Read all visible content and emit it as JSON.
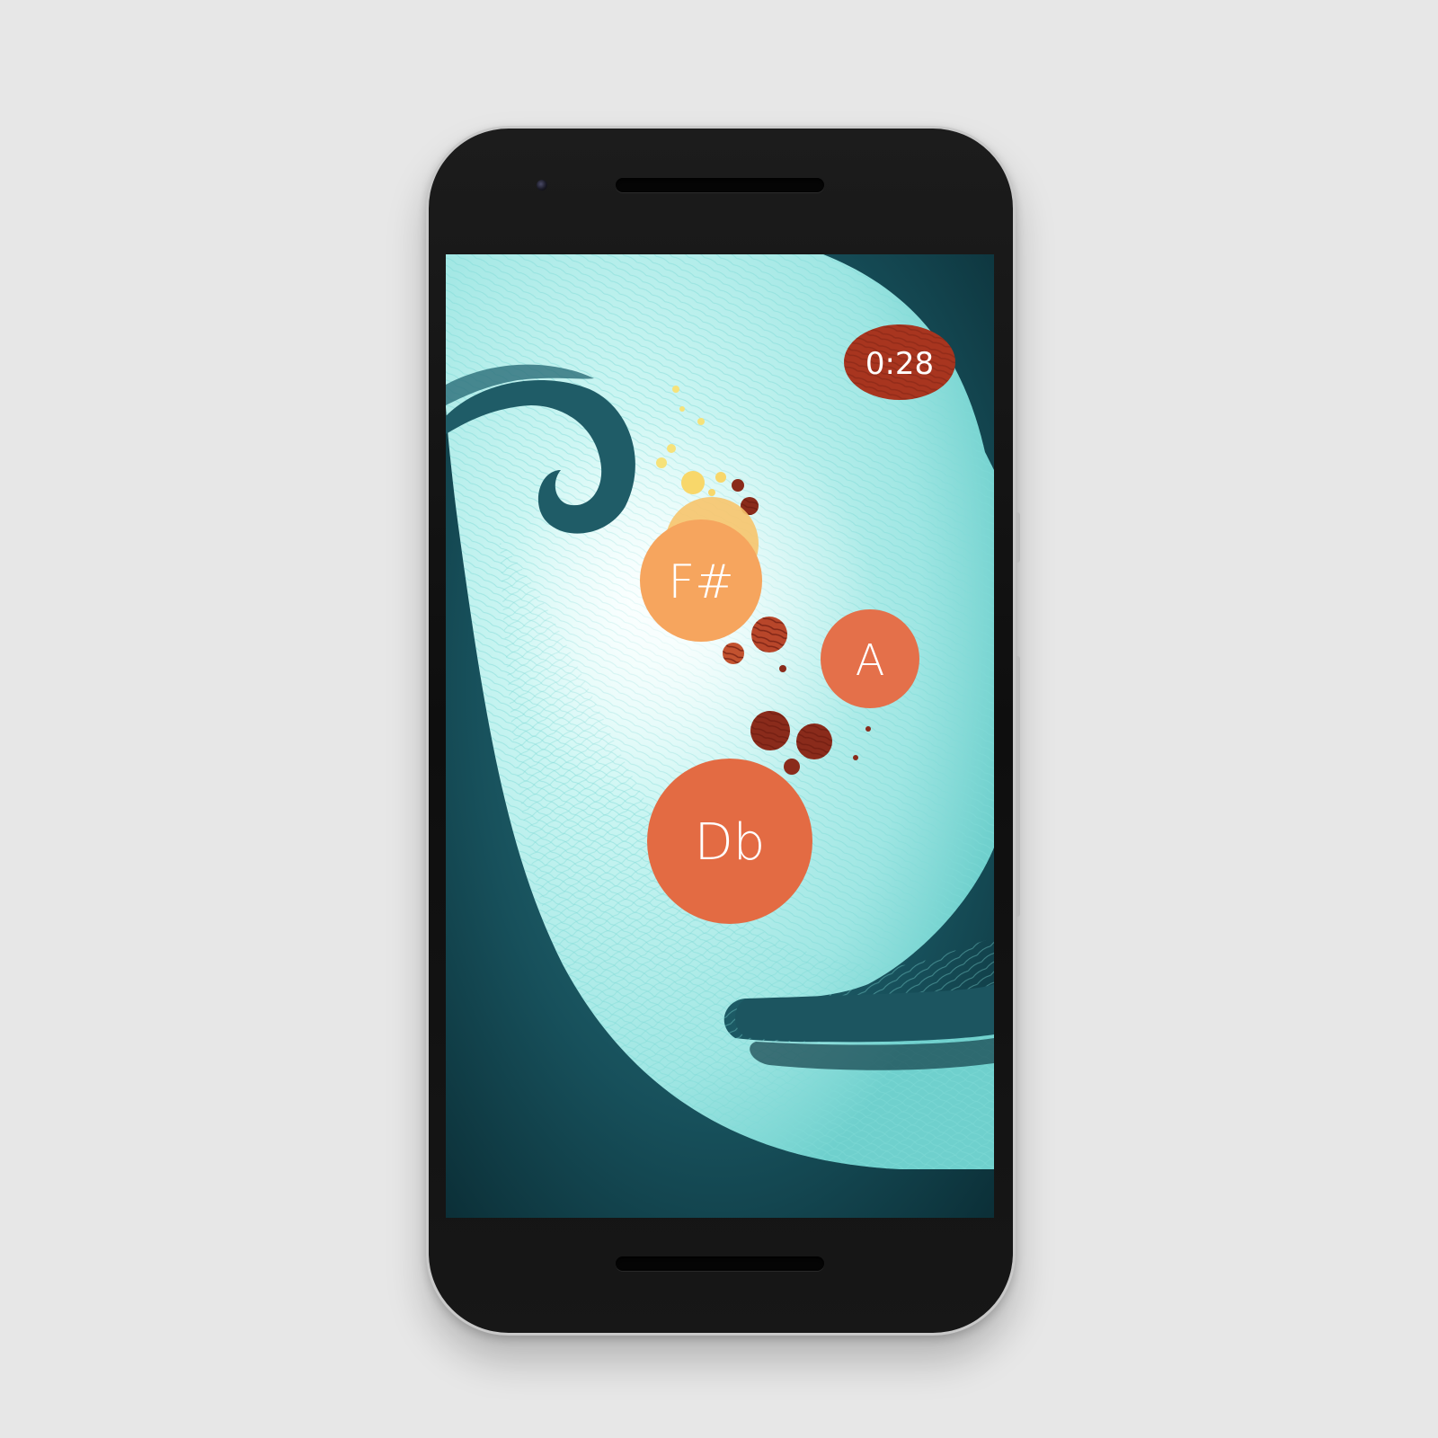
{
  "game": {
    "timer": "0:28",
    "notes": [
      {
        "label": "F#",
        "color": "#f6a55e"
      },
      {
        "label": "A",
        "color": "#e4704a"
      },
      {
        "label": "Db",
        "color": "#e36b43"
      }
    ]
  },
  "colors": {
    "background": "#e7e7e7",
    "bezel": "#151515",
    "sky_dark": "#0f3b45",
    "wave_light": "#bff2ef",
    "wave_outline": "#7fdad6",
    "timer_badge": "#a8351f",
    "note_orange": "#e36b43",
    "note_peach": "#f6a55e"
  },
  "icons": {
    "camera": "front-camera-icon",
    "speaker": "earpiece-speaker-icon"
  }
}
